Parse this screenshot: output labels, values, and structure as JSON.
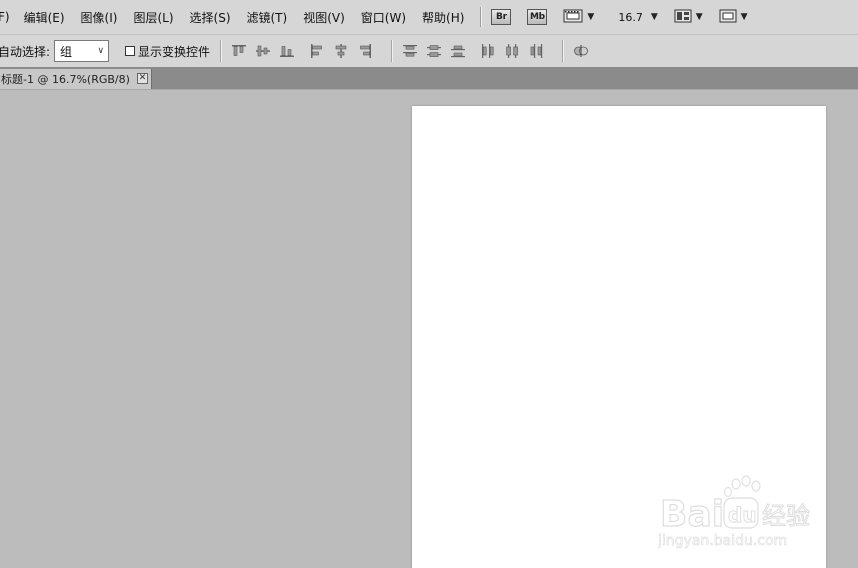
{
  "menubar": {
    "items": [
      "F)",
      "编辑(E)",
      "图像(I)",
      "图层(L)",
      "选择(S)",
      "滤镜(T)",
      "视图(V)",
      "窗口(W)",
      "帮助(H)"
    ],
    "bridge_label": "Br",
    "minibridge_label": "Mb",
    "zoom_value": "16.7"
  },
  "options": {
    "auto_select_label": "自动选择:",
    "auto_select_value": "组",
    "show_transform_label": "显示变换控件",
    "show_transform_checked": false
  },
  "document": {
    "tab_title": "标题-1 @ 16.7%(RGB/8)",
    "close_glyph": "✕"
  },
  "watermark": {
    "brand": "Baidu",
    "brand_cn": "经验",
    "url": "jingyan.baidu.com"
  },
  "colors": {
    "ui_gray": "#d6d6d6",
    "workspace": "#bcbcbc",
    "canvas": "#ffffff",
    "tab_strip": "#8b8b8b"
  }
}
